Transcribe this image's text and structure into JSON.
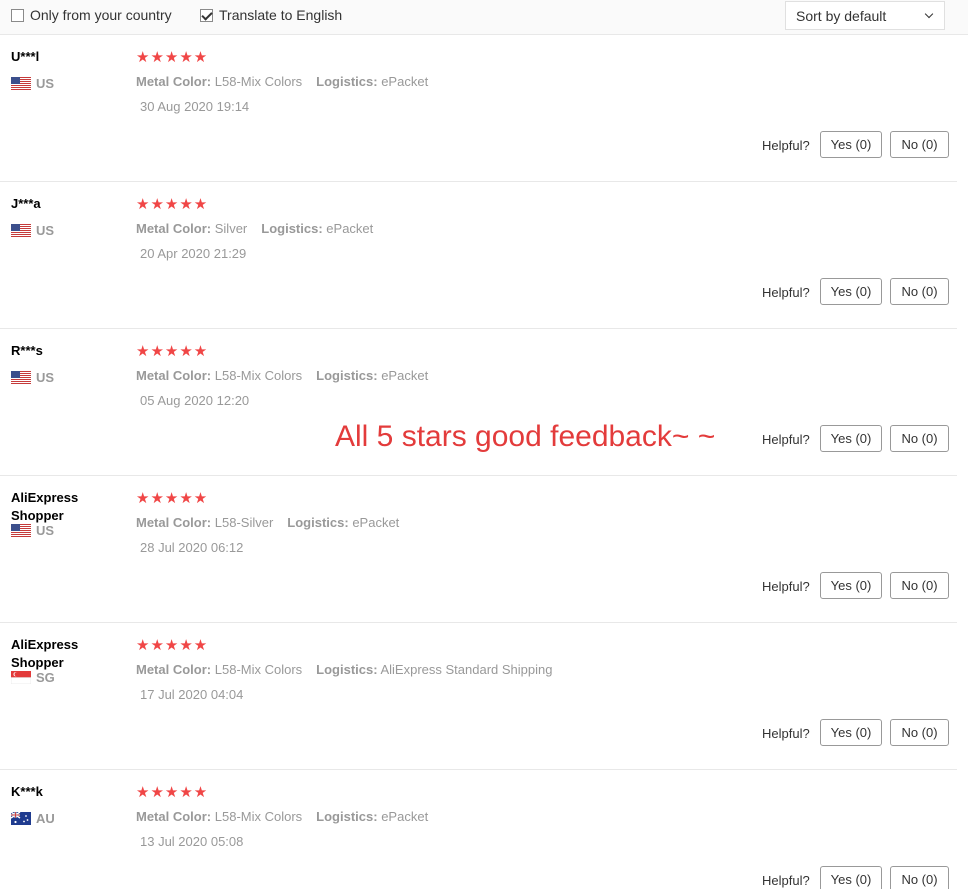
{
  "filters": {
    "only_country_label": "Only from your country",
    "only_country_checked": false,
    "translate_label": "Translate to English",
    "translate_checked": true,
    "sort_value": "Sort by default"
  },
  "overlay_caption": "All 5 stars good feedback~ ~",
  "colors": {
    "star": "#f04646",
    "caption": "#e33b3b"
  },
  "reviews": [
    {
      "user_line1": "U***l",
      "user_line2": "",
      "country": "US",
      "flag": "us-flag-icon",
      "stars": "★★★★★",
      "rating": 5,
      "attr1_label": "Metal Color:",
      "attr1_value": "L58-Mix Colors",
      "attr2_label": "Logistics:",
      "attr2_value": "ePacket",
      "date": "30 Aug 2020 19:14",
      "helpful_label": "Helpful?",
      "yes_label": "Yes (0)",
      "no_label": "No (0)"
    },
    {
      "user_line1": "J***a",
      "user_line2": "",
      "country": "US",
      "flag": "us-flag-icon",
      "stars": "★★★★★",
      "rating": 5,
      "attr1_label": "Metal Color:",
      "attr1_value": "Silver",
      "attr2_label": "Logistics:",
      "attr2_value": "ePacket",
      "date": "20 Apr 2020 21:29",
      "helpful_label": "Helpful?",
      "yes_label": "Yes (0)",
      "no_label": "No (0)"
    },
    {
      "user_line1": "R***s",
      "user_line2": "",
      "country": "US",
      "flag": "us-flag-icon",
      "stars": "★★★★★",
      "rating": 5,
      "attr1_label": "Metal Color:",
      "attr1_value": "L58-Mix Colors",
      "attr2_label": "Logistics:",
      "attr2_value": "ePacket",
      "date": "05 Aug 2020 12:20",
      "helpful_label": "Helpful?",
      "yes_label": "Yes (0)",
      "no_label": "No (0)"
    },
    {
      "user_line1": "AliExpress",
      "user_line2": "Shopper",
      "country": "US",
      "flag": "us-flag-icon",
      "stars": "★★★★★",
      "rating": 5,
      "attr1_label": "Metal Color:",
      "attr1_value": "L58-Silver",
      "attr2_label": "Logistics:",
      "attr2_value": "ePacket",
      "date": "28 Jul 2020 06:12",
      "helpful_label": "Helpful?",
      "yes_label": "Yes (0)",
      "no_label": "No (0)"
    },
    {
      "user_line1": "AliExpress",
      "user_line2": "Shopper",
      "country": "SG",
      "flag": "sg-flag-icon",
      "stars": "★★★★★",
      "rating": 5,
      "attr1_label": "Metal Color:",
      "attr1_value": "L58-Mix Colors",
      "attr2_label": "Logistics:",
      "attr2_value": "AliExpress Standard Shipping",
      "date": "17 Jul 2020 04:04",
      "helpful_label": "Helpful?",
      "yes_label": "Yes (0)",
      "no_label": "No (0)"
    },
    {
      "user_line1": "K***k",
      "user_line2": "",
      "country": "AU",
      "flag": "au-flag-icon",
      "stars": "★★★★★",
      "rating": 5,
      "attr1_label": "Metal Color:",
      "attr1_value": "L58-Mix Colors",
      "attr2_label": "Logistics:",
      "attr2_value": "ePacket",
      "date": "13 Jul 2020 05:08",
      "helpful_label": "Helpful?",
      "yes_label": "Yes (0)",
      "no_label": "No (0)"
    }
  ]
}
